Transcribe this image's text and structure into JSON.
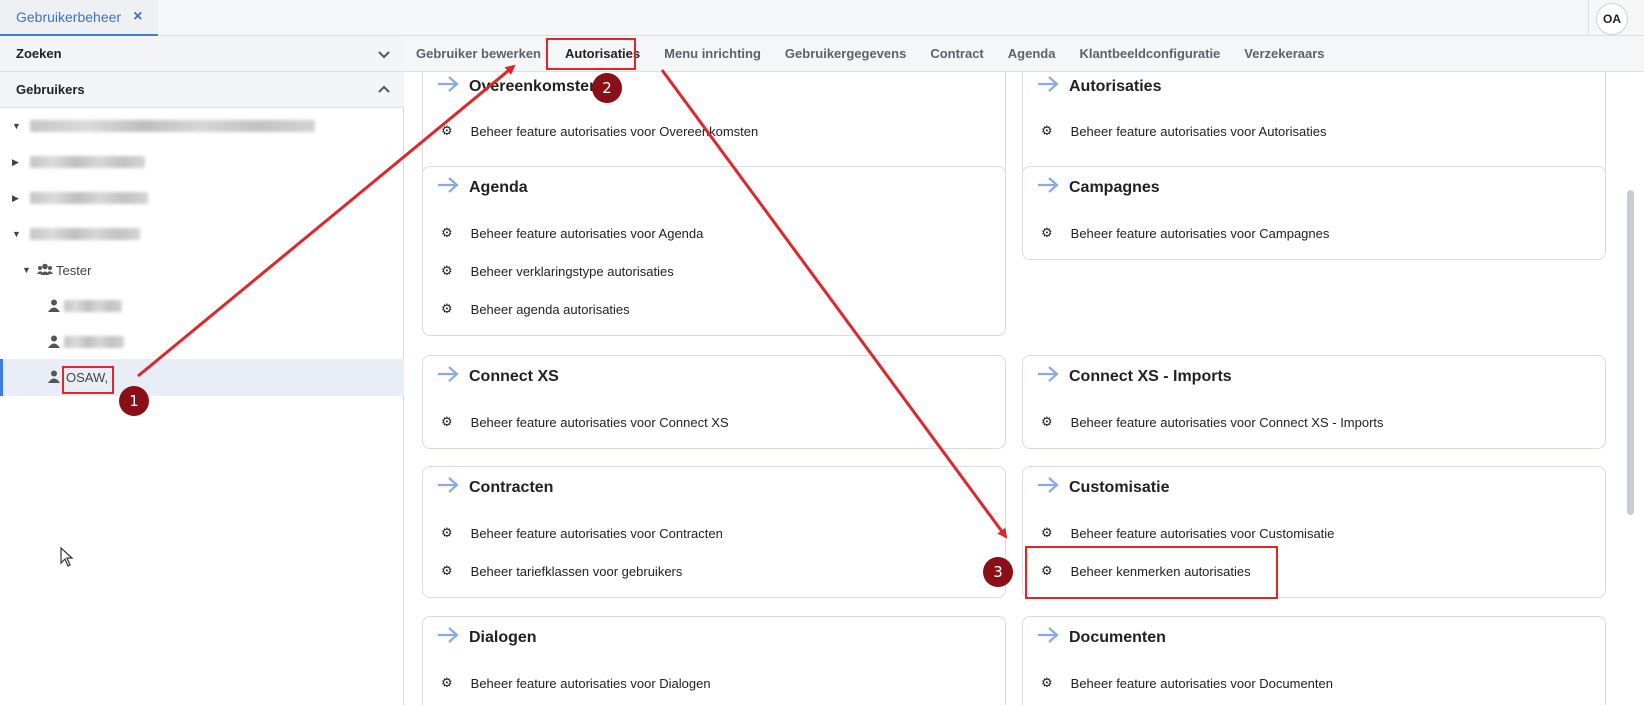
{
  "app_tab": {
    "label": "Gebruikerbeheer",
    "close_glyph": "×"
  },
  "avatar": {
    "initials": "OA"
  },
  "left_panel": {
    "search_header": "Zoeken",
    "users_header": "Gebruikers",
    "tree": {
      "group_label": "Tester",
      "selected_user": "OSAW,"
    }
  },
  "subtabs": [
    "Gebruiker bewerken",
    "Autorisaties",
    "Menu inrichting",
    "Gebruikergegevens",
    "Contract",
    "Agenda",
    "Klantbeeldconfiguratie",
    "Verzekeraars"
  ],
  "active_subtab": "Autorisaties",
  "cards": [
    {
      "title": "Overeenkomsten",
      "items": [
        "Beheer feature autorisaties voor Overeenkomsten"
      ]
    },
    {
      "title": "Autorisaties",
      "items": [
        "Beheer feature autorisaties voor Autorisaties"
      ]
    },
    {
      "title": "Agenda",
      "items": [
        "Beheer feature autorisaties voor Agenda",
        "Beheer verklaringstype autorisaties",
        "Beheer agenda autorisaties"
      ]
    },
    {
      "title": "Campagnes",
      "items": [
        "Beheer feature autorisaties voor Campagnes"
      ]
    },
    {
      "title": "Connect XS",
      "items": [
        "Beheer feature autorisaties voor Connect XS"
      ]
    },
    {
      "title": "Connect XS - Imports",
      "items": [
        "Beheer feature autorisaties voor Connect XS - Imports"
      ]
    },
    {
      "title": "Contracten",
      "items": [
        "Beheer feature autorisaties voor Contracten",
        "Beheer tariefklassen voor gebruikers"
      ]
    },
    {
      "title": "Customisatie",
      "items": [
        "Beheer feature autorisaties voor Customisatie",
        "Beheer kenmerken autorisaties"
      ]
    },
    {
      "title": "Dialogen",
      "items": [
        "Beheer feature autorisaties voor Dialogen"
      ]
    },
    {
      "title": "Documenten",
      "items": [
        "Beheer feature autorisaties voor Documenten"
      ]
    }
  ],
  "annotations": {
    "step1": "1",
    "step2": "2",
    "step3": "3"
  },
  "colors": {
    "accent": "#3d7be0",
    "annotation_red": "#e0262b",
    "badge": "#8b0f17",
    "arrow_icon": "#8aa9e8"
  },
  "icons": {
    "arrow": "arrow-right-icon",
    "gear": "gear-icon",
    "user": "user-icon",
    "group": "users-icon",
    "chevron": "chevron-icon"
  }
}
